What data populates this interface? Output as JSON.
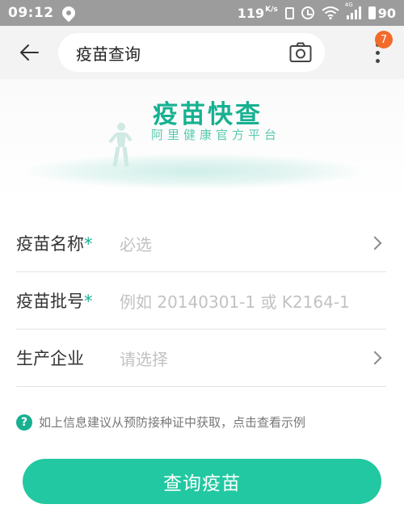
{
  "status_bar": {
    "time": "09:12",
    "net_speed": "119",
    "net_speed_unit": "K/s",
    "network_type": "4G",
    "battery": "90"
  },
  "header": {
    "title": "疫苗查询",
    "notification_count": "7"
  },
  "banner": {
    "title": "疫苗快查",
    "subtitle": "阿里健康官方平台"
  },
  "form": {
    "rows": [
      {
        "label": "疫苗名称",
        "required_mark": "*",
        "placeholder": "必选"
      },
      {
        "label": "疫苗批号",
        "required_mark": "*",
        "placeholder": "例如 20140301-1 或 K2164-1"
      },
      {
        "label": "生产企业",
        "required_mark": "",
        "placeholder": "请选择"
      }
    ]
  },
  "hint": {
    "icon_text": "?",
    "text": "如上信息建议从预防接种证中获取，点击查看示例"
  },
  "submit_label": "查询疫苗",
  "colors": {
    "accent": "#17b191",
    "button": "#22c8a1",
    "badge": "#f26b2a",
    "status_bar": "#9c9c9c"
  }
}
